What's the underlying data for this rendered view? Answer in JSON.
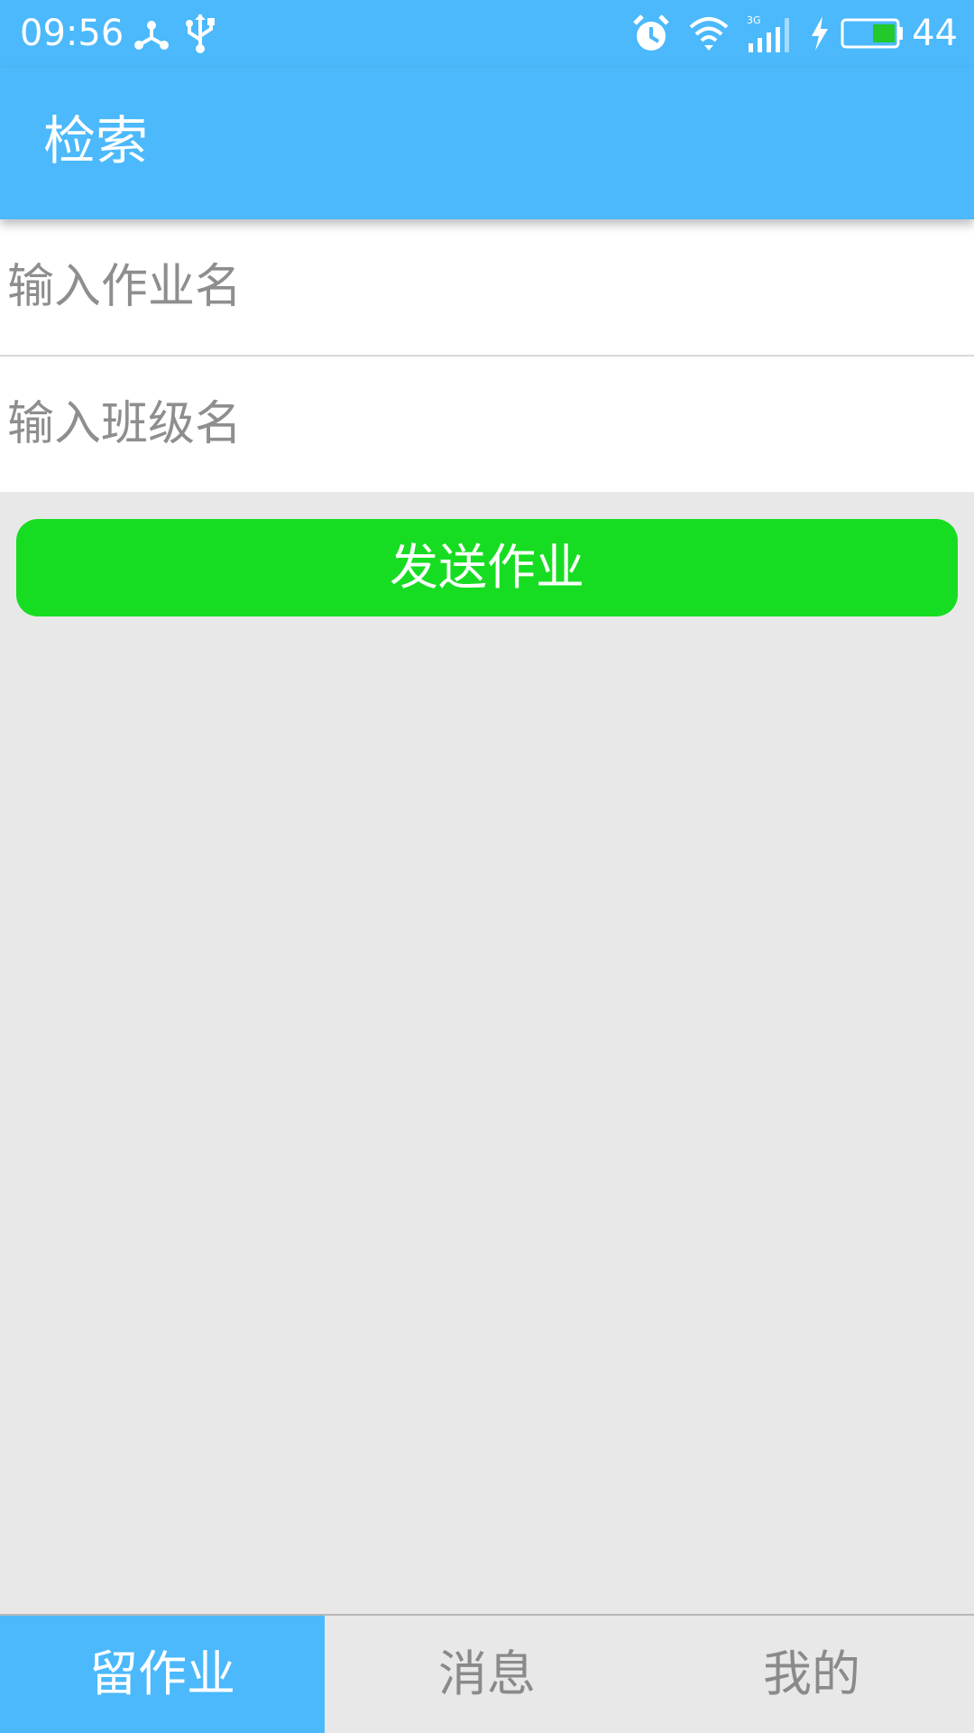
{
  "status_bar": {
    "time": "09:56",
    "battery_percent": "44",
    "network": "3G",
    "icons": [
      "share-icon",
      "usb-icon",
      "alarm-icon",
      "wifi-icon",
      "signal-icon",
      "charging-icon",
      "battery-icon"
    ]
  },
  "app_bar": {
    "title": "检索"
  },
  "form": {
    "homework_name_placeholder": "输入作业名",
    "homework_name_value": "",
    "class_name_placeholder": "输入班级名",
    "class_name_value": "",
    "send_label": "发送作业"
  },
  "bottom_nav": {
    "tabs": [
      {
        "label": "留作业",
        "active": true
      },
      {
        "label": "消息",
        "active": false
      },
      {
        "label": "我的",
        "active": false
      }
    ]
  },
  "colors": {
    "primary": "#4bb9fb",
    "send_button": "#17dd22",
    "background": "#e8e8e8"
  }
}
